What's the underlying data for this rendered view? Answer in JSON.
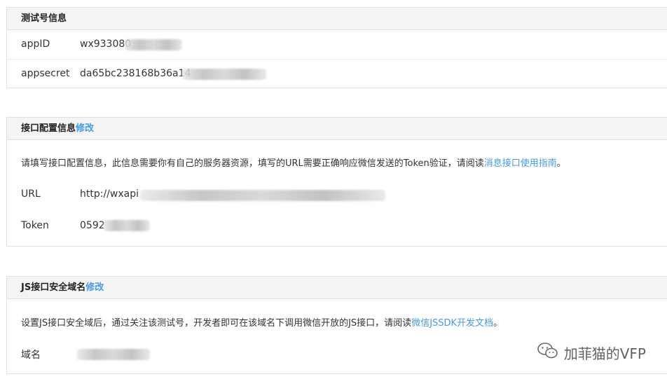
{
  "testInfo": {
    "title": "测试号信息",
    "rows": [
      {
        "label": "appID",
        "value": "wx933080"
      },
      {
        "label": "appsecret",
        "value": "da65bc238168b36a14"
      }
    ]
  },
  "interfaceConfig": {
    "title": "接口配置信息",
    "edit": "修改",
    "desc_prefix": "请填写接口配置信息，此信息需要你有自己的服务器资源，填写的URL需要正确响应微信发送的Token验证，请阅读",
    "desc_link": "消息接口使用指南",
    "desc_suffix": "。",
    "url_label": "URL",
    "url_value": "http://wxapi",
    "token_label": "Token",
    "token_value": "0592"
  },
  "jsDomain": {
    "title": "JS接口安全域名",
    "edit": "修改",
    "desc_prefix": "设置JS接口安全域后，通过关注该测试号，开发者即可在该域名下调用微信开放的JS接口，请阅读",
    "desc_link": "微信JSSDK开发文档",
    "desc_suffix": "。",
    "domain_label": "域名"
  },
  "watermark": {
    "icon": "wechat-icon",
    "text": "加菲猫的VFP"
  },
  "colors": {
    "link": "#459ae9",
    "header_bg": "#f4f4f4",
    "border": "#e2e2e2"
  }
}
